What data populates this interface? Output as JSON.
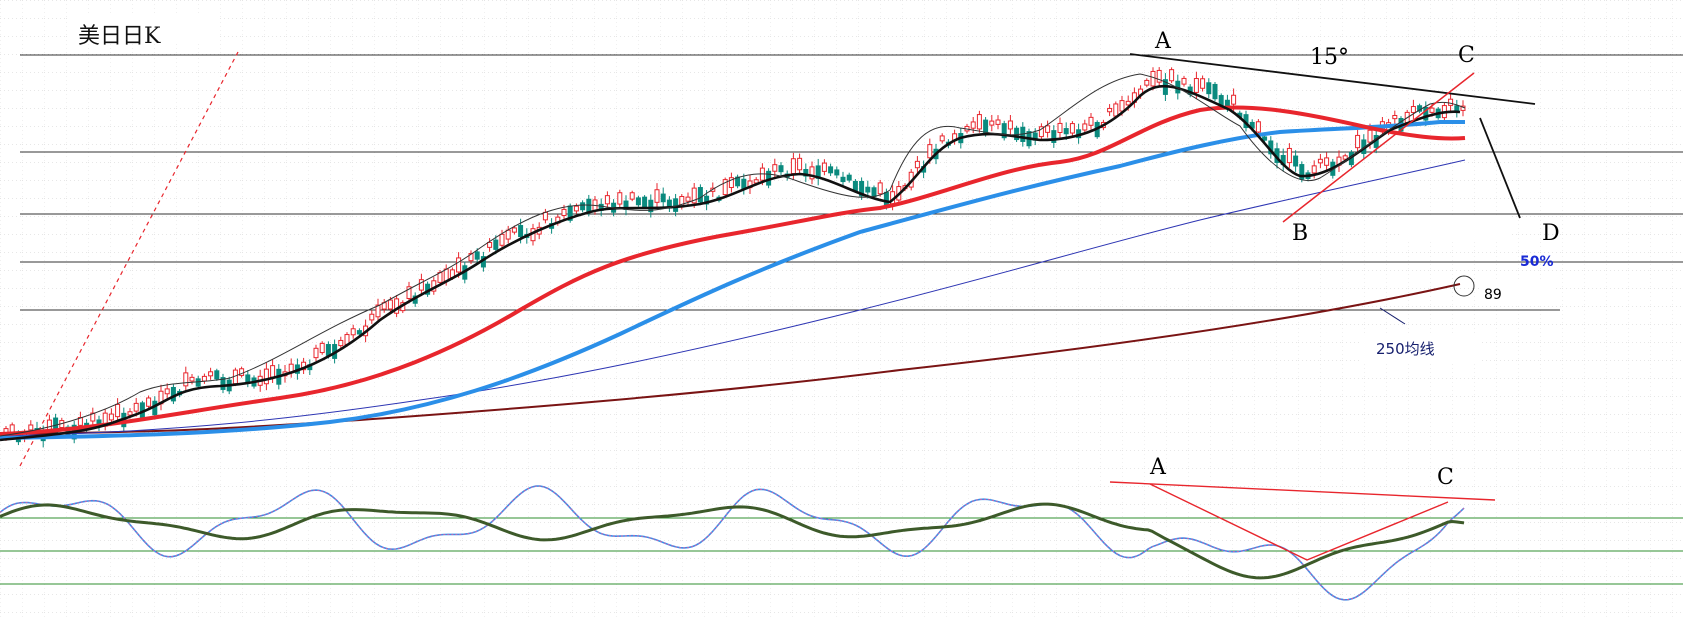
{
  "title": "美日日K",
  "labels": {
    "a_main": "A",
    "angle": "15°",
    "c_main": "C",
    "b_main": "B",
    "d_main": "D",
    "pct": "50%",
    "n89": "89",
    "ma250": "250均线",
    "a_osc": "A",
    "c_osc": "C"
  },
  "colors": {
    "bull": "#e8262d",
    "bear": "#0a8a7e",
    "ma_black": "#111111",
    "ma_red": "#e8262d",
    "ma_blue": "#2b8fe8",
    "ma_thin_blue": "#2d35b3",
    "ma_250": "#7a1414",
    "osc_fast": "#3a8ee8",
    "osc_slow": "#3d5a2a",
    "trend_red": "#e8262d",
    "osc_guides": "#2f8f2f"
  },
  "chart_data": {
    "type": "candlestick",
    "indicators": [
      "moving averages",
      "oscillator"
    ],
    "ma_lines": [
      {
        "name": "250均线"
      }
    ],
    "grid": true,
    "annotations": [
      "A",
      "B",
      "C",
      "D",
      "15°",
      "50%",
      "89",
      "250均线"
    ]
  }
}
